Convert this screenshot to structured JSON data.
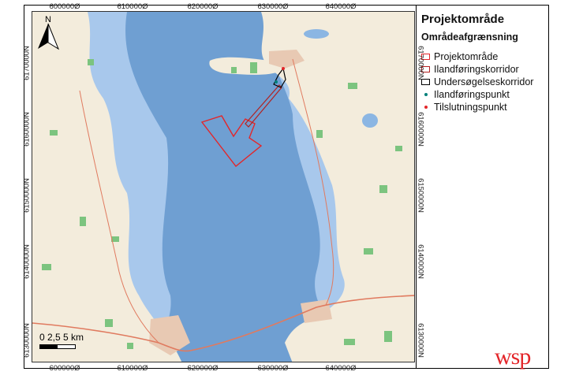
{
  "coords": {
    "x_labels": [
      "600000Ø",
      "610000Ø",
      "620000Ø",
      "630000Ø",
      "640000Ø"
    ],
    "y_labels": [
      "6170000N",
      "6160000N",
      "6150000N",
      "6140000N",
      "6130000N"
    ]
  },
  "north_arrow": {
    "label": "N"
  },
  "scale_bar": {
    "label": "0  2,5   5 km"
  },
  "legend": {
    "title": "Projektområde",
    "subtitle": "Områdeafgrænsning",
    "items": [
      {
        "label": "Projektområde",
        "kind": "box",
        "color": "#e3262a"
      },
      {
        "label": "Ilandføringskorridor",
        "kind": "box",
        "color": "#b22222"
      },
      {
        "label": "Undersøgelseskorridor",
        "kind": "box",
        "color": "#000000"
      },
      {
        "label": "Ilandføringspunkt",
        "kind": "dot",
        "color": "#00807a"
      },
      {
        "label": "Tilslutningspunkt",
        "kind": "dot",
        "color": "#e3262a"
      }
    ]
  },
  "logo": {
    "text": "wsp"
  },
  "colors": {
    "sea": "#6f9fd2",
    "shallow": "#a8c8ec",
    "land": "#f3ecdc",
    "forest": "#7cc47f",
    "urban": "#e8c9b3",
    "road": "#e07a5f"
  }
}
